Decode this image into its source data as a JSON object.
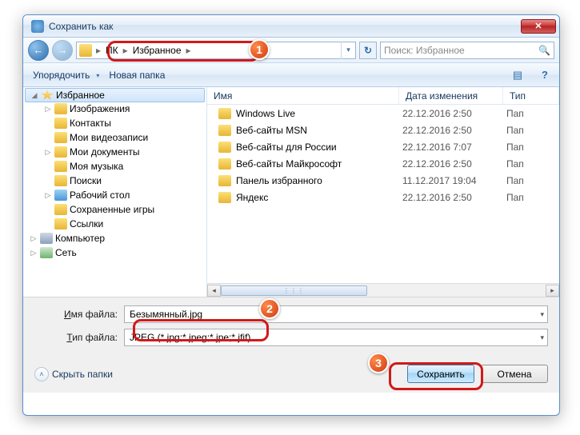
{
  "window": {
    "title": "Сохранить как"
  },
  "nav": {
    "crumbs": [
      "ПК",
      "Избранное"
    ],
    "search_placeholder": "Поиск: Избранное"
  },
  "toolbar": {
    "organize": "Упорядочить",
    "new_folder": "Новая папка"
  },
  "tree": {
    "items": [
      {
        "label": "Избранное",
        "icon": "star",
        "level": 2,
        "exp": "◢",
        "sel": true
      },
      {
        "label": "Изображения",
        "icon": "folder",
        "level": 2,
        "exp": "▷"
      },
      {
        "label": "Контакты",
        "icon": "folder",
        "level": 2,
        "exp": ""
      },
      {
        "label": "Мои видеозаписи",
        "icon": "folder",
        "level": 2,
        "exp": ""
      },
      {
        "label": "Мои документы",
        "icon": "folder",
        "level": 2,
        "exp": "▷"
      },
      {
        "label": "Моя музыка",
        "icon": "folder",
        "level": 2,
        "exp": ""
      },
      {
        "label": "Поиски",
        "icon": "folder",
        "level": 2,
        "exp": ""
      },
      {
        "label": "Рабочий стол",
        "icon": "blue",
        "level": 2,
        "exp": "▷"
      },
      {
        "label": "Сохраненные игры",
        "icon": "folder",
        "level": 2,
        "exp": ""
      },
      {
        "label": "Ссылки",
        "icon": "folder",
        "level": 2,
        "exp": ""
      },
      {
        "label": "Компьютер",
        "icon": "comp",
        "level": 1,
        "exp": "▷"
      },
      {
        "label": "Сеть",
        "icon": "net",
        "level": 1,
        "exp": "▷"
      }
    ]
  },
  "list": {
    "headers": {
      "name": "Имя",
      "date": "Дата изменения",
      "type": "Тип"
    },
    "rows": [
      {
        "name": "Windows Live",
        "date": "22.12.2016 2:50",
        "type": "Папка"
      },
      {
        "name": "Веб-сайты MSN",
        "date": "22.12.2016 2:50",
        "type": "Папка"
      },
      {
        "name": "Веб-сайты для России",
        "date": "22.12.2016 7:07",
        "type": "Папка"
      },
      {
        "name": "Веб-сайты Майкрософт",
        "date": "22.12.2016 2:50",
        "type": "Папка"
      },
      {
        "name": "Панель избранного",
        "date": "11.12.2017 19:04",
        "type": "Папка"
      },
      {
        "name": "Яндекс",
        "date": "22.12.2016 2:50",
        "type": "Папка"
      }
    ]
  },
  "form": {
    "filename_label_pre": "Имя файла",
    "filename_value": "Безымянный.jpg",
    "filetype_label_pre": "Тип файла",
    "filetype_value": "JPEG (*.jpg;*.jpeg;*.jpe;*.jfif)"
  },
  "bottom": {
    "hide_folders": "Скрыть папки",
    "save": "Сохранить",
    "cancel": "Отмена"
  },
  "badges": {
    "b1": "1",
    "b2": "2",
    "b3": "3"
  }
}
